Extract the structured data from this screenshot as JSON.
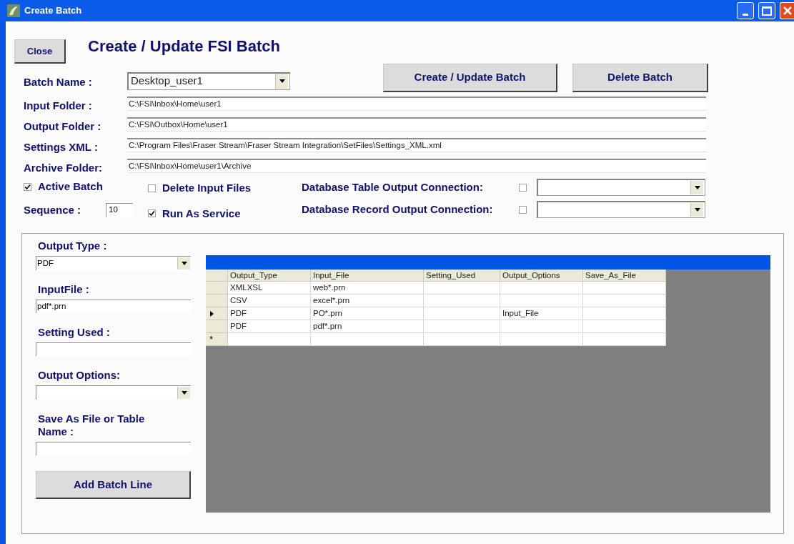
{
  "window": {
    "title": "Create Batch"
  },
  "header": {
    "close_button": "Close",
    "title": "Create / Update FSI Batch"
  },
  "batch_name": {
    "label": "Batch Name :",
    "value": "Desktop_user1"
  },
  "actions": [
    "Create / Update Batch",
    "Delete Batch"
  ],
  "paths": [
    {
      "label": "Input Folder :",
      "value": "C:\\FSI\\Inbox\\Home\\user1"
    },
    {
      "label": "Output Folder :",
      "value": "C:\\FSI\\Outbox\\Home\\user1"
    },
    {
      "label": "Settings XML :",
      "value": "C:\\Program Files\\Fraser Stream\\Fraser Stream Integration\\SetFiles\\Settings_XML.xml"
    },
    {
      "label": "Archive Folder:",
      "value": "C:\\FSI\\Inbox\\Home\\user1\\Archive"
    }
  ],
  "active_batch": {
    "label": "Active Batch",
    "checked": true
  },
  "sequence": {
    "label": "Sequence :",
    "value": "10"
  },
  "delete_input_files": {
    "label": "Delete Input Files",
    "checked": false
  },
  "run_as_service": {
    "label": "Run As Service",
    "checked": true
  },
  "connections": [
    {
      "label": "Database Table Output Connection:",
      "checked": false
    },
    {
      "label": "Database Record Output Connection:",
      "checked": false
    }
  ],
  "line_form": {
    "fields": [
      {
        "kind": "combo",
        "label": "Output Type :",
        "value": "PDF"
      },
      {
        "kind": "text",
        "label": "InputFile :",
        "value": "pdf*.prn"
      },
      {
        "kind": "text",
        "label": "Setting Used :"
      },
      {
        "kind": "combo",
        "label": "Output Options:"
      },
      {
        "kind": "text",
        "label": "Save As File or Table Name :"
      }
    ],
    "add_button": "Add Batch Line"
  },
  "grid": {
    "columns": [
      "Output_Type",
      "Input_File",
      "Setting_Used",
      "Output_Options",
      "Save_As_File"
    ],
    "rows": [
      {
        "current": false,
        "cells": [
          "XMLXSL",
          "web*.prn",
          "",
          "",
          ""
        ]
      },
      {
        "current": false,
        "cells": [
          "CSV",
          "excel*.prn",
          "",
          "",
          ""
        ]
      },
      {
        "current": true,
        "cells": [
          "PDF",
          "PO*.prn",
          "",
          "Input_File",
          ""
        ]
      },
      {
        "current": false,
        "cells": [
          "PDF",
          "pdf*.prn",
          "",
          "",
          ""
        ]
      }
    ],
    "new_row_marker": "*"
  }
}
